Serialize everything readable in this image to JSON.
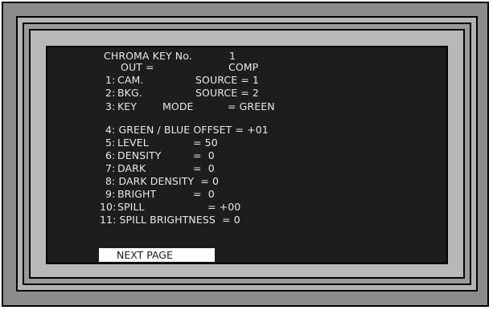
{
  "menu": {
    "title": "CHROMA KEY No.",
    "title_number": "1",
    "out_label": "OUT =",
    "out_value": "COMP",
    "items": [
      {
        "num": "1:",
        "label": "CAM.",
        "param": "SOURCE = 1"
      },
      {
        "num": "2:",
        "label": "BKG.",
        "param": "SOURCE = 2"
      },
      {
        "num": "3:",
        "label": "KEY",
        "param": "MODE",
        "value": "= GREEN"
      },
      {
        "text": "4: GREEN / BLUE OFFSET = +01"
      },
      {
        "num": "5:",
        "label": "LEVEL",
        "value": "= 50"
      },
      {
        "num": "6:",
        "label": "DENSITY",
        "value": "=  0"
      },
      {
        "num": "7:",
        "label": "DARK",
        "value": "=  0"
      },
      {
        "text": "8: DARK DENSITY  = 0"
      },
      {
        "num": "9:",
        "label": "BRIGHT",
        "value": "=  0"
      },
      {
        "num": "10:",
        "label": "SPILL",
        "value": "= +00"
      },
      {
        "text": "11: SPILL BRIGHTNESS  = 0"
      }
    ],
    "next_page_label": "NEXT PAGE"
  }
}
